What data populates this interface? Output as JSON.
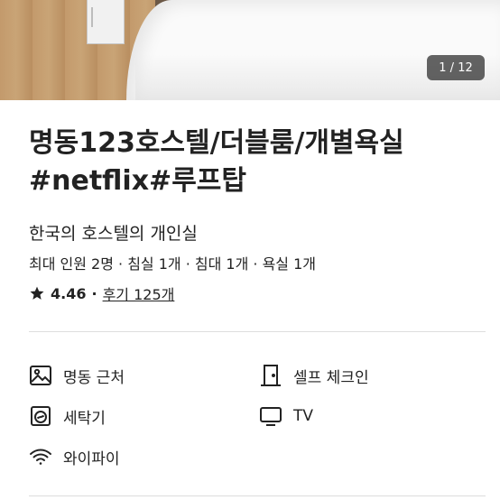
{
  "gallery": {
    "counter_current": "1",
    "counter_separator": " / ",
    "counter_total": "12"
  },
  "listing": {
    "title_line1": "명동123호스텔/더블룸/개별욕실",
    "title_line2": "#netflix#루프탑",
    "subtitle": "한국의 호스텔의 개인실",
    "details": "최대 인원 2명 · 침실 1개 · 침대 1개 · 욕실 1개",
    "rating": "4.46",
    "rating_separator": "·",
    "reviews_link": "후기 125개"
  },
  "amenities": [
    {
      "label": "명동 근처",
      "icon": "landscape-icon"
    },
    {
      "label": "셀프 체크인",
      "icon": "door-icon"
    },
    {
      "label": "세탁기",
      "icon": "washer-icon"
    },
    {
      "label": "TV",
      "icon": "tv-icon"
    },
    {
      "label": "와이파이",
      "icon": "wifi-icon"
    }
  ],
  "colors": {
    "text": "#222222",
    "divider": "#dddddd",
    "counter_bg": "#282828"
  }
}
